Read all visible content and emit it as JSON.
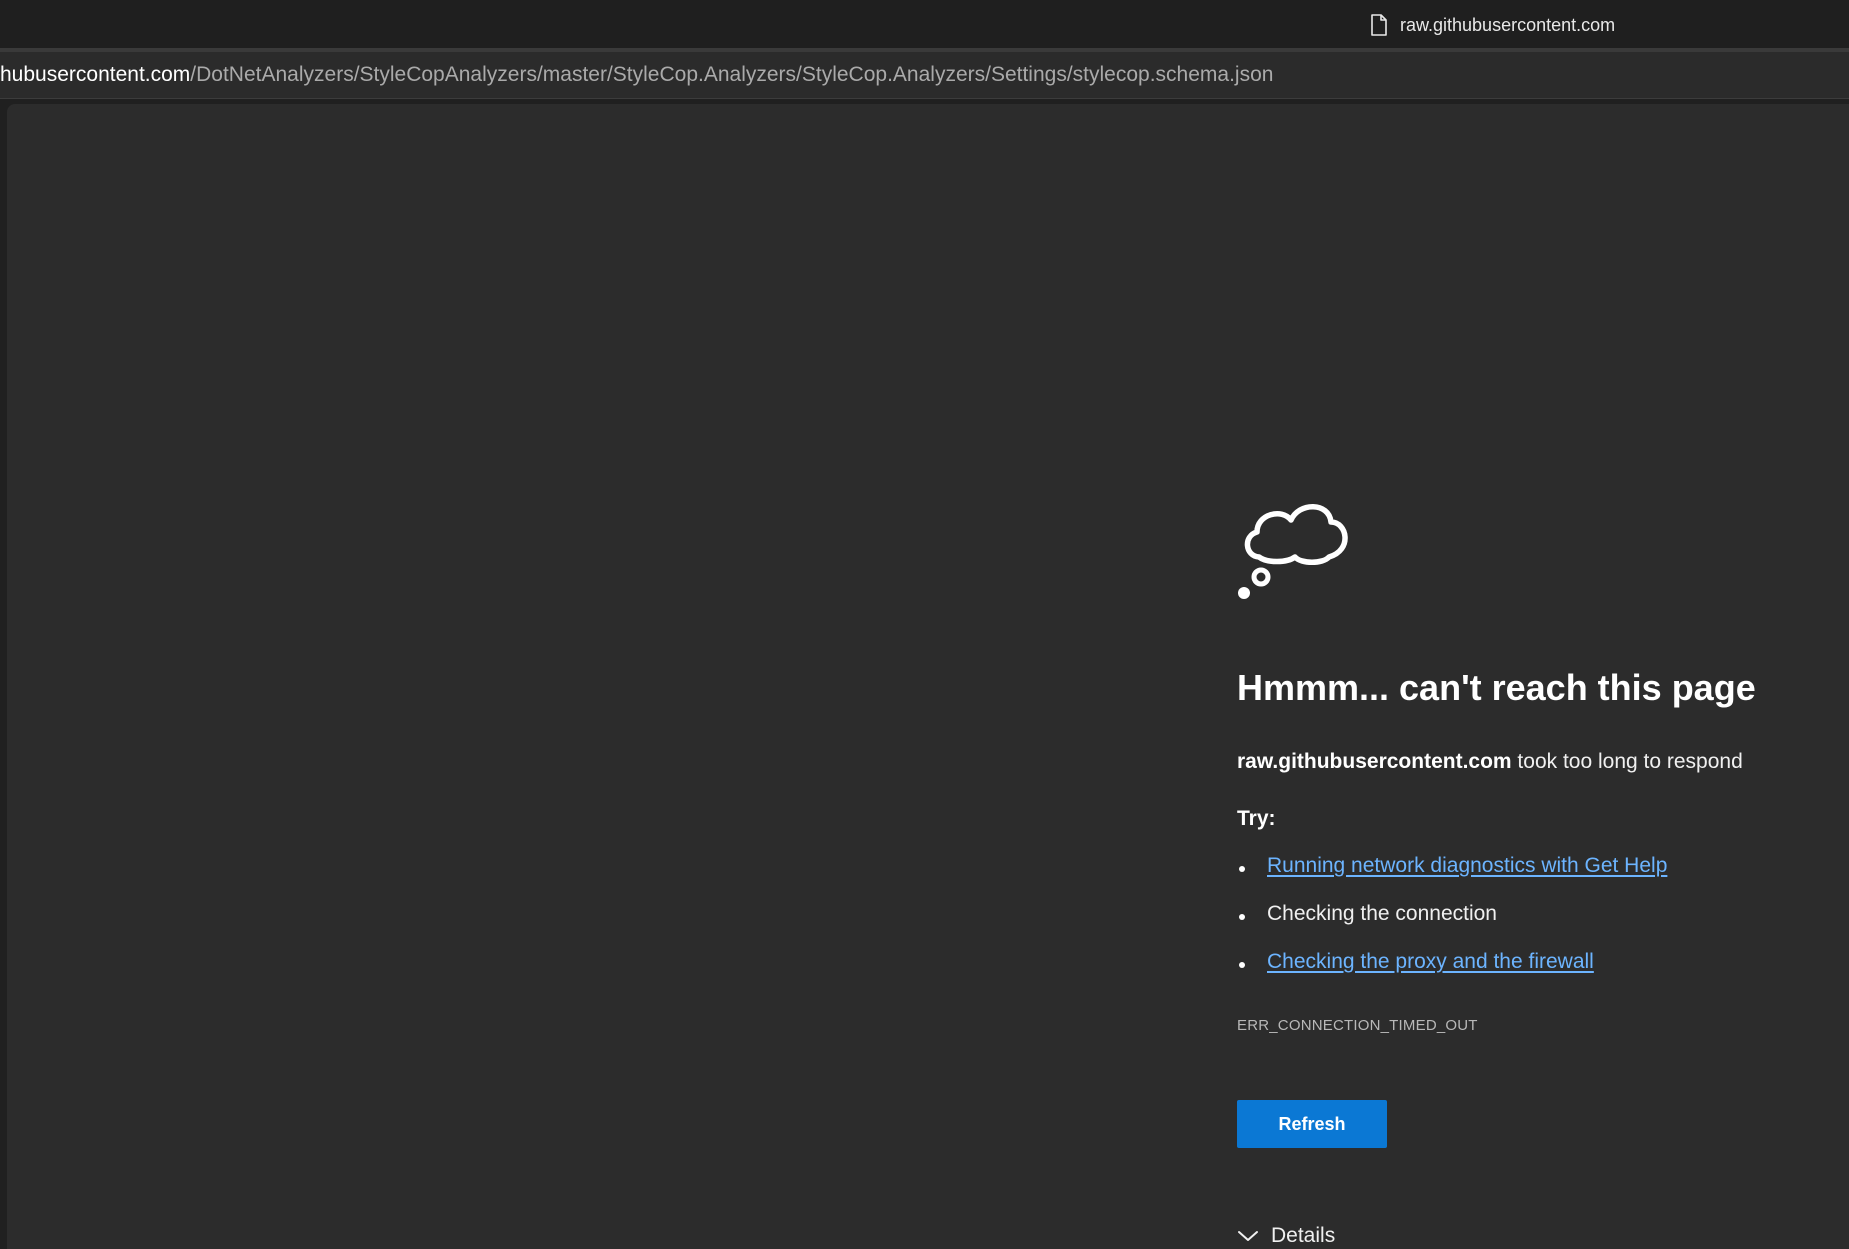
{
  "tab": {
    "title": "raw.githubusercontent.com",
    "icon": "page-icon"
  },
  "address": {
    "host": "hubusercontent.com",
    "path": "/DotNetAnalyzers/StyleCopAnalyzers/master/StyleCop.Analyzers/StyleCop.Analyzers/Settings/stylecop.schema.json"
  },
  "error": {
    "icon": "thought-cloud-icon",
    "heading": "Hmmm... can't reach this page",
    "host": "raw.githubusercontent.com",
    "message": " took too long to respond",
    "try_label": "Try:",
    "suggestions": [
      {
        "text": "Running network diagnostics with Get Help",
        "link": true
      },
      {
        "text": "Checking the connection",
        "link": false
      },
      {
        "text": "Checking the proxy and the firewall",
        "link": true
      }
    ],
    "code": "ERR_CONNECTION_TIMED_OUT",
    "refresh_label": "Refresh",
    "details_label": "Details"
  },
  "colors": {
    "accent": "#0b78d4",
    "link": "#6cb4ff",
    "page_bg": "#2c2c2c"
  }
}
